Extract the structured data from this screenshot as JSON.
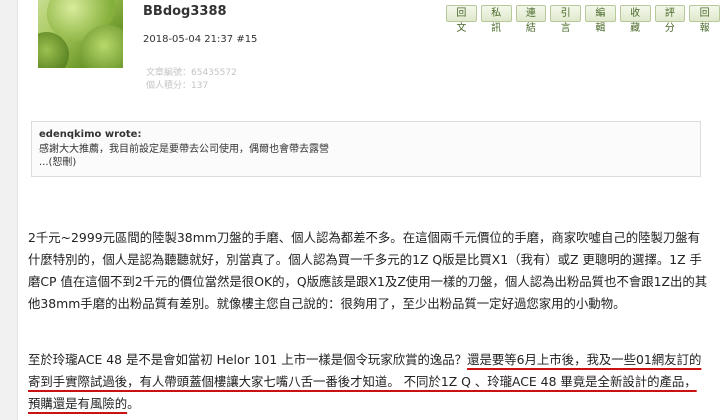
{
  "post": {
    "username": "BBdog3388",
    "datetime": "2018-05-04 21:37",
    "floor": "#15",
    "stats": [
      "文章編號：65435572",
      "個人積分：137"
    ]
  },
  "toolbar": {
    "buttons": [
      {
        "name": "reply-button",
        "label": "回文"
      },
      {
        "name": "message-button",
        "label": "私訊"
      },
      {
        "name": "link-button",
        "label": "連結"
      },
      {
        "name": "quote-button",
        "label": "引言"
      },
      {
        "name": "edit-button",
        "label": "編輯"
      },
      {
        "name": "bookmark-button",
        "label": "收藏"
      },
      {
        "name": "rate-button",
        "label": "評分"
      },
      {
        "name": "report-button",
        "label": "回報"
      }
    ]
  },
  "quote": {
    "author": "edenqkimo wrote:",
    "lines": [
      "感謝大大推薦，我目前設定是要帶去公司使用，偶爾也會帶去露營",
      "...(恕刪)"
    ]
  },
  "content": {
    "paragraph1": "2千元~2999元區間的陸製38mm刀盤的手磨、個人認為都差不多。在這個兩千元價位的手磨，商家吹噓自己的陸製刀盤有什麼特別的，個人是認為聽聽就好，別當真了。個人認為買一千多元的1Z Q版是比買X1（我有）或Z 更聰明的選擇。1Z 手磨CP 值在這個不到2千元的價位當然是很OK的，Q版應該是跟X1及Z使用一樣的刀盤，個人認為出粉品質也不會跟1Z出的其他38mm手磨的出粉品質有差別。就像樓主您自己說的：很夠用了，至少出粉品質一定好過您家用的小動物。",
    "paragraph2_plain": "至於玲瓏ACE 48 是不是會如當初 Helor 101 上市一樣是個令玩家欣賞的逸品？",
    "paragraph2_underlined": "還是要等6月上市後，我及一些01網友訂的寄到手實際試過後，有人帶頭蓋個樓讓大家七嘴八舌一番後才知道。 不同於1Z Q 、玲瓏ACE 48 畢竟是全新設計的產品，預購還是有風險的",
    "paragraph2_end": "。"
  },
  "colors": {
    "underline": "#cc1111",
    "button_text": "#4a6a2a"
  }
}
